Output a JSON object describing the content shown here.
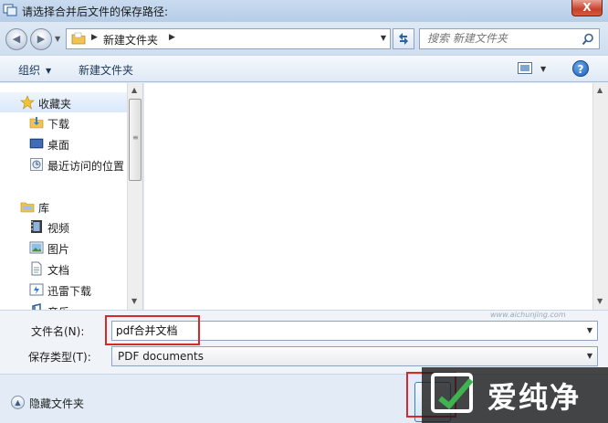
{
  "window": {
    "title": "请选择合并后文件的保存路径:",
    "close_label": "X"
  },
  "address": {
    "crumb": "新建文件夹",
    "search_placeholder": "搜索 新建文件夹"
  },
  "toolbar": {
    "organize": "组织",
    "new_folder": "新建文件夹",
    "help": "?"
  },
  "navpane": {
    "items": [
      {
        "label": "收藏夹",
        "icon": "star-icon"
      },
      {
        "label": "下载",
        "icon": "download-folder-icon"
      },
      {
        "label": "桌面",
        "icon": "desktop-icon"
      },
      {
        "label": "最近访问的位置",
        "icon": "recent-places-icon"
      },
      {
        "label": "库",
        "icon": "library-icon"
      },
      {
        "label": "视频",
        "icon": "video-icon"
      },
      {
        "label": "图片",
        "icon": "picture-icon"
      },
      {
        "label": "文档",
        "icon": "document-icon"
      },
      {
        "label": "迅雷下载",
        "icon": "thunder-download-icon"
      },
      {
        "label": "音乐",
        "icon": "music-icon"
      }
    ]
  },
  "fields": {
    "filename_label": "文件名(N):",
    "filename_value": "pdf合并文档",
    "filetype_label": "保存类型(T):",
    "filetype_value": "PDF documents"
  },
  "footer": {
    "hide_folders": "隐藏文件夹"
  },
  "watermark": {
    "text": "爱纯净",
    "url": "www.aichunjing.com"
  },
  "colors": {
    "highlight": "#d12b2b",
    "close": "#c7412a"
  }
}
